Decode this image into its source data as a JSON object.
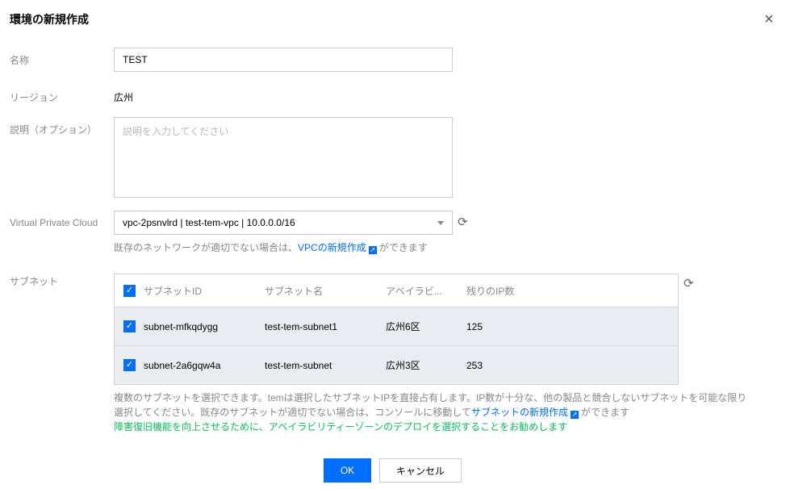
{
  "dialog": {
    "title": "環境の新規作成",
    "close": "×"
  },
  "form": {
    "name": {
      "label": "名称",
      "value": "TEST"
    },
    "region": {
      "label": "リージョン",
      "value": "広州"
    },
    "description": {
      "label": "説明（オプション）",
      "placeholder": "説明を入力してください"
    },
    "vpc": {
      "label": "Virtual Private Cloud",
      "value": "vpc-2psnvlrd | test-tem-vpc | 10.0.0.0/16",
      "help_prefix": "既存のネットワークが適切でない場合は、",
      "help_link": "VPCの新規作成",
      "help_suffix": "ができます"
    },
    "subnet": {
      "label": "サブネット",
      "columns": [
        "サブネットID",
        "サブネット名",
        "アベイラビ...",
        "残りのIP数"
      ],
      "rows": [
        {
          "id": "subnet-mfkqdygg",
          "name": "test-tem-subnet1",
          "zone": "広州6区",
          "ips": "125",
          "checked": true
        },
        {
          "id": "subnet-2a6gqw4a",
          "name": "test-tem-subnet",
          "zone": "広州3区",
          "ips": "253",
          "checked": true
        }
      ],
      "help_line1": "複数のサブネットを選択できます。temは選択したサブネットIPを直接占有します。IP数が十分な、他の製品と競合しないサブネットを可能な限り",
      "help_line2_prefix": "選択してください。既存のサブネットが適切でない場合は、コンソールに移動して",
      "help_link": "サブネットの新規作成",
      "help_line2_suffix": "ができます",
      "recommend": "障害復旧機能を向上させるために、アベイラビリティーゾーンのデプロイを選択することをお勧めします"
    }
  },
  "buttons": {
    "ok": "OK",
    "cancel": "キャンセル"
  },
  "colors": {
    "primary": "#006eff",
    "success": "#0abf5b"
  }
}
